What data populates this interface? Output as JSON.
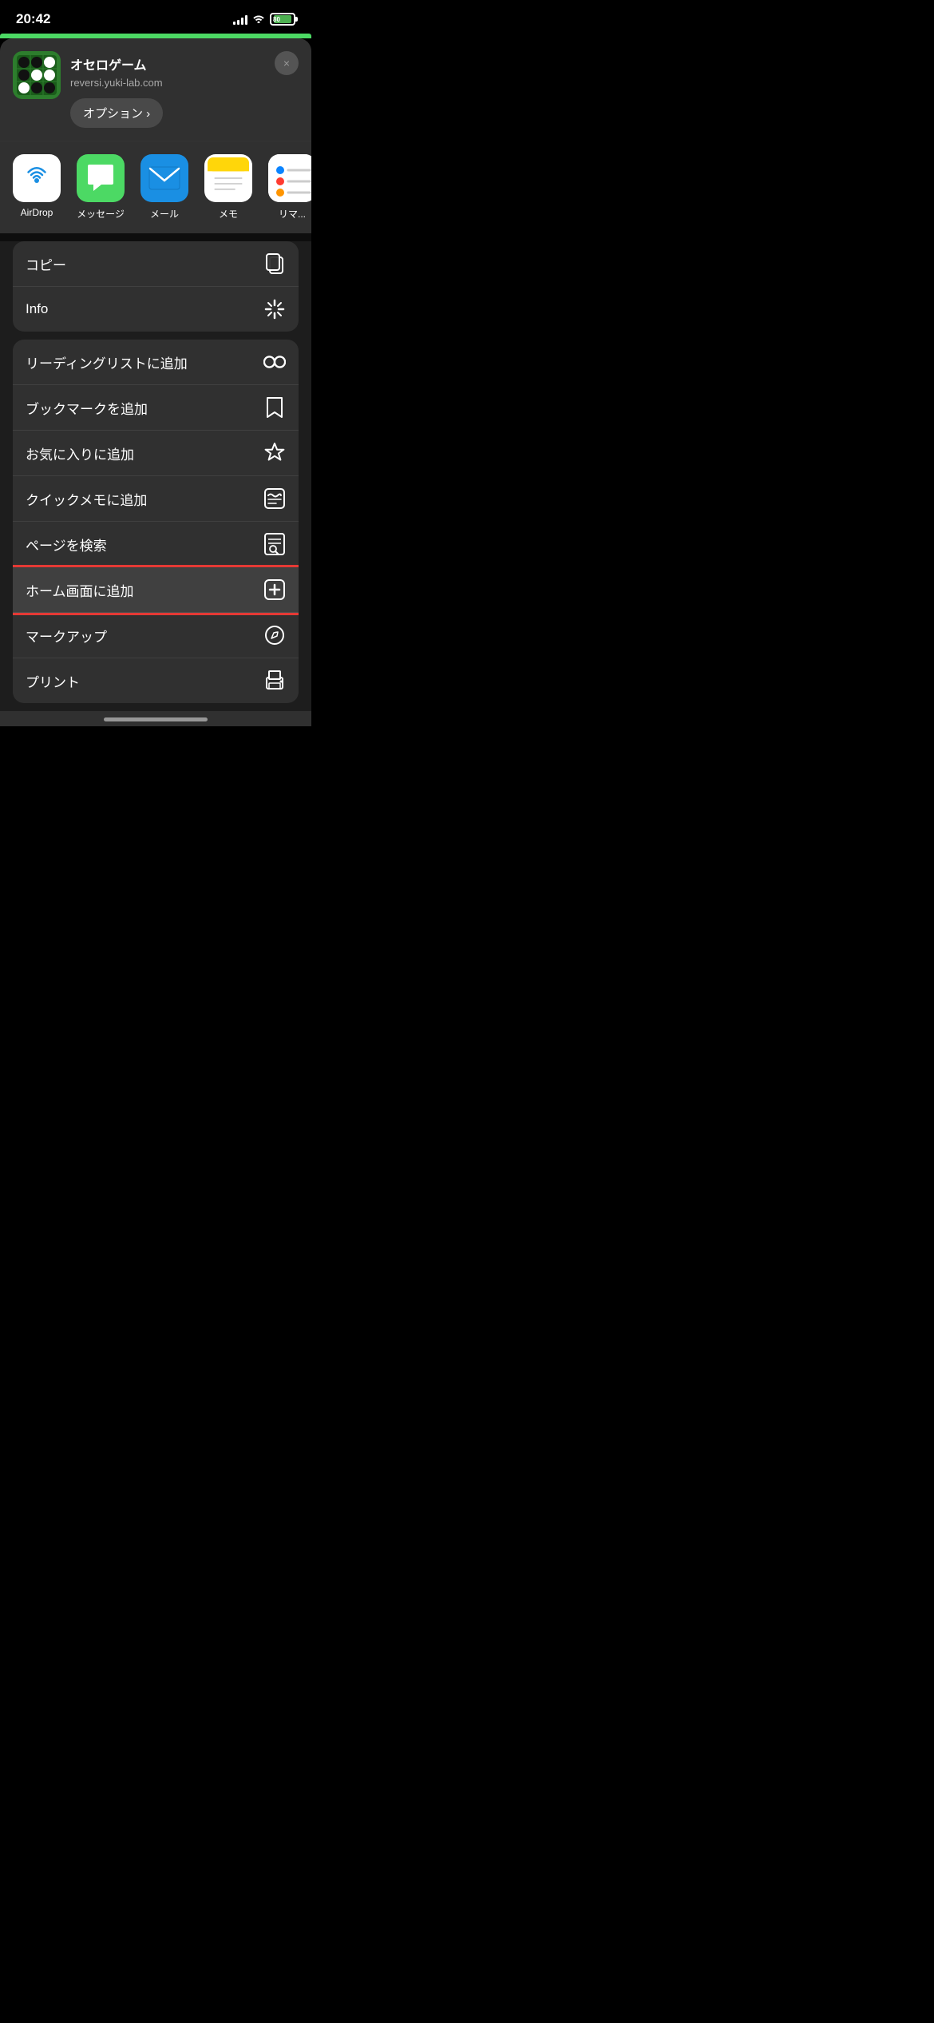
{
  "statusBar": {
    "time": "20:42",
    "battery": "80"
  },
  "shareHeader": {
    "siteTitle": "オセロゲーム",
    "siteUrl": "reversi.yuki-lab.com",
    "optionsLabel": "オプション ›",
    "closeLabel": "×"
  },
  "appRow": {
    "items": [
      {
        "id": "airdrop",
        "label": "AirDrop"
      },
      {
        "id": "messages",
        "label": "メッセージ"
      },
      {
        "id": "mail",
        "label": "メール"
      },
      {
        "id": "notes",
        "label": "メモ"
      },
      {
        "id": "reminders",
        "label": "リマ..."
      }
    ]
  },
  "menuGroup1": {
    "items": [
      {
        "id": "copy",
        "label": "コピー",
        "icon": "copy"
      },
      {
        "id": "info",
        "label": "Info",
        "icon": "sparkle"
      }
    ]
  },
  "menuGroup2": {
    "items": [
      {
        "id": "reading-list",
        "label": "リーディングリストに追加",
        "icon": "glasses"
      },
      {
        "id": "add-bookmark",
        "label": "ブックマークを追加",
        "icon": "book"
      },
      {
        "id": "add-favorites",
        "label": "お気に入りに追加",
        "icon": "star"
      },
      {
        "id": "quick-note",
        "label": "クイックメモに追加",
        "icon": "quicknote"
      },
      {
        "id": "find-page",
        "label": "ページを検索",
        "icon": "find"
      },
      {
        "id": "add-home",
        "label": "ホーム画面に追加",
        "icon": "plus-square",
        "highlighted": true
      },
      {
        "id": "markup",
        "label": "マークアップ",
        "icon": "markup"
      },
      {
        "id": "print",
        "label": "プリント",
        "icon": "print"
      }
    ]
  },
  "homeIndicator": {}
}
